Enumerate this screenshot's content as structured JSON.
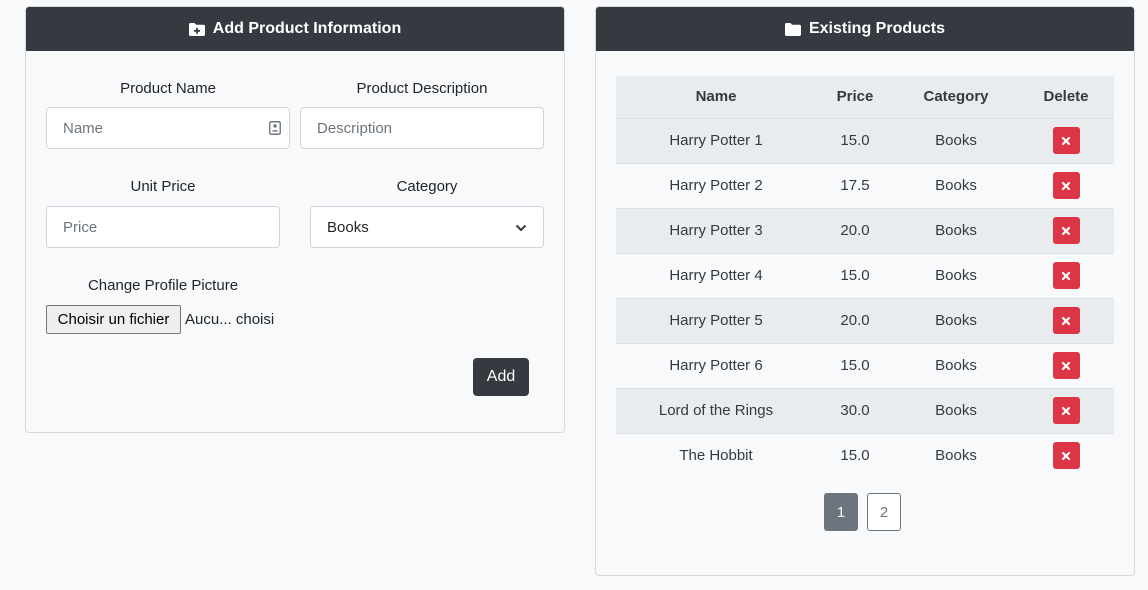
{
  "add_form": {
    "title": "Add Product Information",
    "title_icon": "folder-plus-icon",
    "product_name_label": "Product Name",
    "product_name_placeholder": "Name",
    "product_description_label": "Product Description",
    "product_description_placeholder": "Description",
    "unit_price_label": "Unit Price",
    "unit_price_placeholder": "Price",
    "category_label": "Category",
    "category_selected": "Books",
    "picture_label": "Change Profile Picture",
    "file_button_label": "Choisir un fichier",
    "file_status": "Aucu... choisi",
    "add_button_label": "Add"
  },
  "products": {
    "title": "Existing Products",
    "title_icon": "folder-icon",
    "columns": [
      "Name",
      "Price",
      "Category",
      "Delete"
    ],
    "rows": [
      {
        "name": "Harry Potter 1",
        "price": "15.0",
        "category": "Books"
      },
      {
        "name": "Harry Potter 2",
        "price": "17.5",
        "category": "Books"
      },
      {
        "name": "Harry Potter 3",
        "price": "20.0",
        "category": "Books"
      },
      {
        "name": "Harry Potter 4",
        "price": "15.0",
        "category": "Books"
      },
      {
        "name": "Harry Potter 5",
        "price": "20.0",
        "category": "Books"
      },
      {
        "name": "Harry Potter 6",
        "price": "15.0",
        "category": "Books"
      },
      {
        "name": "Lord of the Rings",
        "price": "30.0",
        "category": "Books"
      },
      {
        "name": "The Hobbit",
        "price": "15.0",
        "category": "Books"
      }
    ],
    "pages": [
      "1",
      "2"
    ],
    "current_page": "1"
  },
  "colors": {
    "header_bg": "#343a40",
    "delete_red": "#dc3545",
    "page_active": "#6c757d"
  }
}
